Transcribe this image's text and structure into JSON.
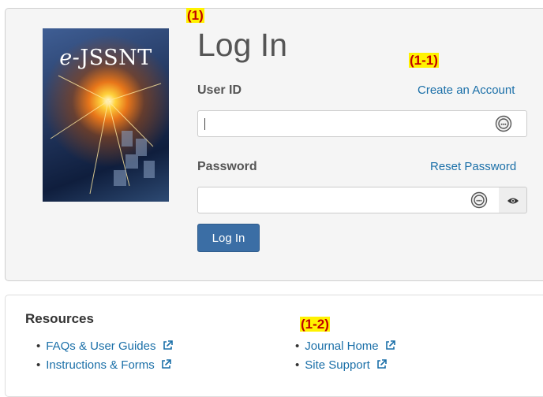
{
  "markers": {
    "m1": "(1)",
    "m1_1": "(1-1)",
    "m1_2": "(1-2)"
  },
  "cover": {
    "prefix": "e-",
    "name": "JSSNT"
  },
  "login": {
    "title": "Log In",
    "user_id_label": "User ID",
    "create_account": "Create an Account",
    "user_id_value": "",
    "password_label": "Password",
    "reset_password": "Reset Password",
    "password_value": "",
    "submit_label": "Log In"
  },
  "resources": {
    "title": "Resources",
    "left_links": [
      "FAQs & User Guides",
      "Instructions & Forms"
    ],
    "right_links": [
      "Journal Home",
      "Site Support"
    ]
  },
  "icons": {
    "password_manager": "password-manager-icon",
    "show_password": "eye-icon",
    "external_link": "external-link-icon"
  },
  "colors": {
    "link": "#1a6fa8",
    "button": "#3b6ea5",
    "marker_bg": "#fff200",
    "marker_text": "#c00000",
    "panel_bg": "#f5f5f5"
  }
}
